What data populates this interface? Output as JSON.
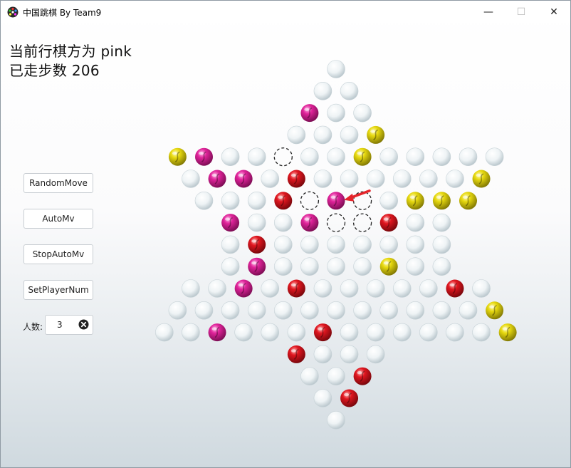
{
  "window": {
    "title": "中国跳棋 By Team9",
    "minimize_glyph": "—",
    "maximize_glyph": "☐",
    "close_glyph": "✕"
  },
  "status": {
    "current_player": "当前行棋方为 pink",
    "steps": "已走步数 206"
  },
  "controls": {
    "random_move": "RandomMove",
    "auto_move": "AutoMv",
    "stop_auto_move": "StopAutoMv",
    "set_player_num": "SetPlayerNum",
    "player_count_label": "人数:",
    "player_count_value": "3"
  },
  "colors": {
    "pink": "#e0239a",
    "red": "#e0161f",
    "yellow": "#e7d90f",
    "empty": "#e7eef1",
    "arrow": "#e5252b"
  },
  "board": {
    "rows": [
      "e",
      "ee",
      "pee",
      "eeey",
      "ypeeoeeyeeeee",
      "eppeReeeeeey",
      "eeeRoPoeyyy",
      "peepooRee",
      "eReeeeeee",
      "epeeeeyee",
      "eepeReeeeeRe",
      "eeeeeeeeeeeey",
      "eepeeeReeeeeey",
      "Reee",
      "eeR",
      "eR",
      "e"
    ],
    "legend_codes": {
      "e": "empty",
      "p": "pink",
      "P": "pink (selected)",
      "R": "red",
      "y": "yellow",
      "o": "possible move target"
    },
    "last_move_arrow": "into selected pink piece"
  }
}
